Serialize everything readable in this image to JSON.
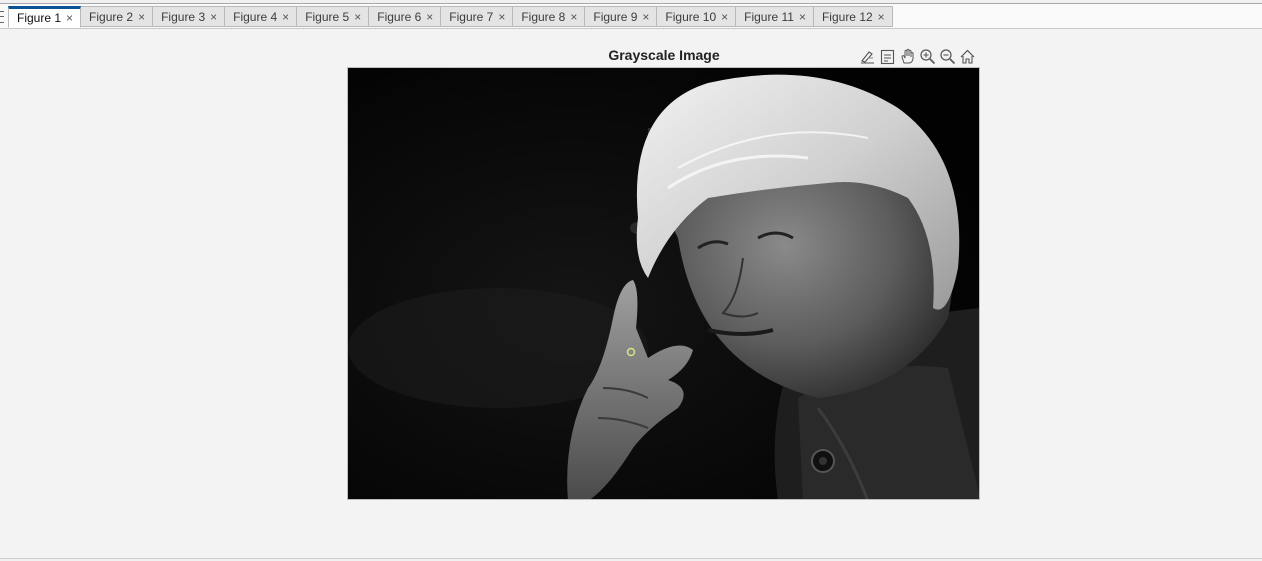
{
  "tabs": [
    {
      "label": "Figure 1",
      "active": true
    },
    {
      "label": "Figure 2",
      "active": false
    },
    {
      "label": "Figure 3",
      "active": false
    },
    {
      "label": "Figure 4",
      "active": false
    },
    {
      "label": "Figure 5",
      "active": false
    },
    {
      "label": "Figure 6",
      "active": false
    },
    {
      "label": "Figure 7",
      "active": false
    },
    {
      "label": "Figure 8",
      "active": false
    },
    {
      "label": "Figure 9",
      "active": false
    },
    {
      "label": "Figure 10",
      "active": false
    },
    {
      "label": "Figure 11",
      "active": false
    },
    {
      "label": "Figure 12",
      "active": false
    }
  ],
  "tab_close_glyph": "×",
  "axes": {
    "title": "Grayscale Image",
    "image_description": "grayscale portrait of an elderly man with white hair, gesturing with raised index finger",
    "toolbar": [
      {
        "name": "brush-icon"
      },
      {
        "name": "datatip-icon"
      },
      {
        "name": "pan-icon"
      },
      {
        "name": "zoom-in-icon"
      },
      {
        "name": "zoom-out-icon"
      },
      {
        "name": "home-icon"
      }
    ]
  }
}
